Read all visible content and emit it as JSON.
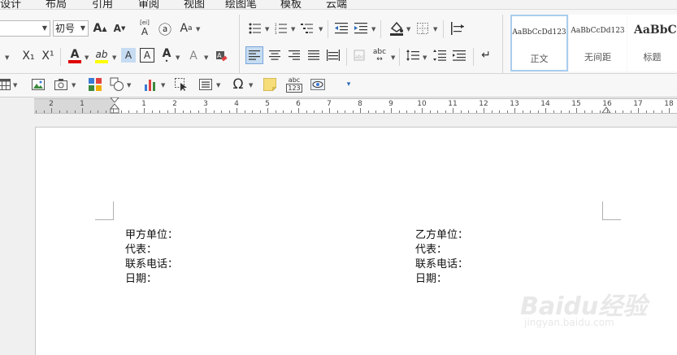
{
  "menu": [
    "设计",
    "布局",
    "引用",
    "审阅",
    "视图",
    "绘图笔",
    "模板",
    "云端"
  ],
  "font": {
    "size_value": "初号"
  },
  "icons": {
    "grow_font": "A↑",
    "shrink_font": "A↓",
    "phonetic": "A",
    "circled": "ⓐ",
    "char_border": "A",
    "subscript": "X₁",
    "superscript": "X¹",
    "font_color": "A",
    "highlight": "ab",
    "shading": "A",
    "char_box": "A",
    "emphasis": "A",
    "effects": "A",
    "clear": "✎",
    "omega": "Ω",
    "abc": "abc"
  },
  "styles": [
    {
      "sample": "AaBbCcDd123",
      "name": "正文"
    },
    {
      "sample": "AaBbCcDd123",
      "name": "无间距"
    },
    {
      "sample": "AaBbCc",
      "name": "标题"
    }
  ],
  "ruler": {
    "left_numbers": [
      "2",
      "1"
    ],
    "right_numbers": [
      "1",
      "2",
      "3",
      "4",
      "5",
      "6",
      "7",
      "8",
      "9",
      "10",
      "11",
      "12",
      "13",
      "14",
      "15",
      "16",
      "17",
      "18"
    ]
  },
  "document": {
    "left": [
      "甲方单位：",
      "代表：",
      "联系电话：",
      "日期："
    ],
    "right": [
      "乙方单位：",
      "代表：",
      "联系电话：",
      "日期："
    ]
  },
  "watermark": {
    "brand": "Baidu经验",
    "url": "jingyan.baidu.com"
  }
}
